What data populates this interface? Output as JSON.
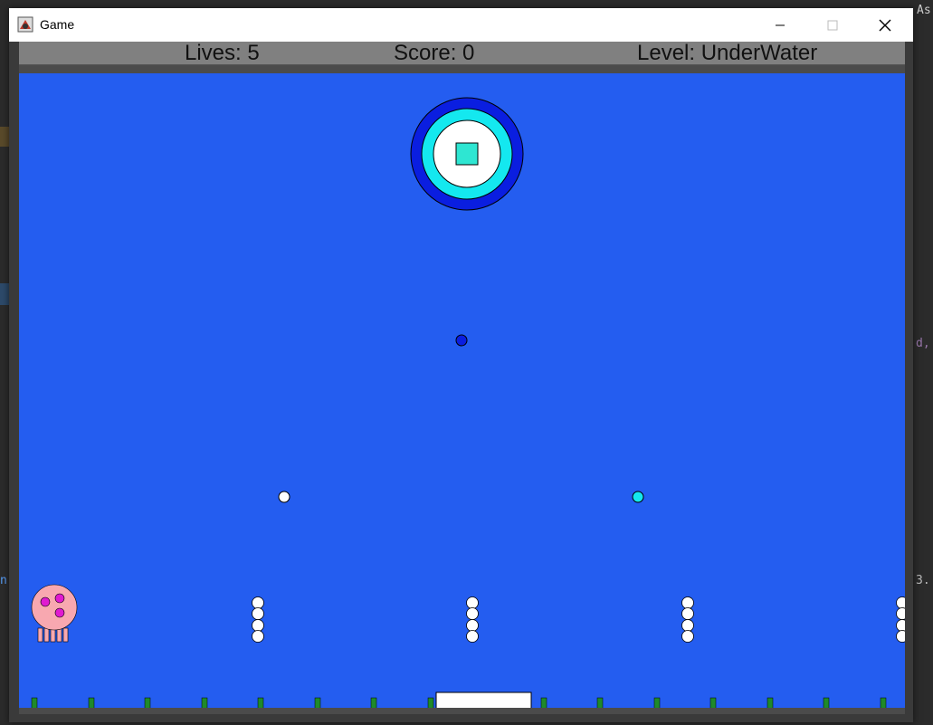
{
  "window": {
    "title": "Game"
  },
  "hud": {
    "lives": "Lives: 5",
    "score": "Score: 0",
    "level": "Level: UnderWater"
  },
  "ide": {
    "top_right_text": "As",
    "right_mid_text": "d,",
    "right_low_text": "3.",
    "left_low_text": "n"
  },
  "colors": {
    "water": "#245df0",
    "frame": "#4b4b4b",
    "hud_bar": "#808080",
    "paddle": "#ffffff",
    "seaweed": "#1f8a2a",
    "target_outer": "#0a1ee0",
    "target_ring": "#14e8ef",
    "target_inner": "#ffffff",
    "target_square": "#2ee6d2",
    "jellyfish": "#f8a8b0",
    "jellyfish_spots": "#e01ad0"
  },
  "icons": {
    "app": "java-app-icon",
    "minimize": "minimize-icon",
    "maximize": "maximize-icon",
    "close": "close-icon"
  }
}
